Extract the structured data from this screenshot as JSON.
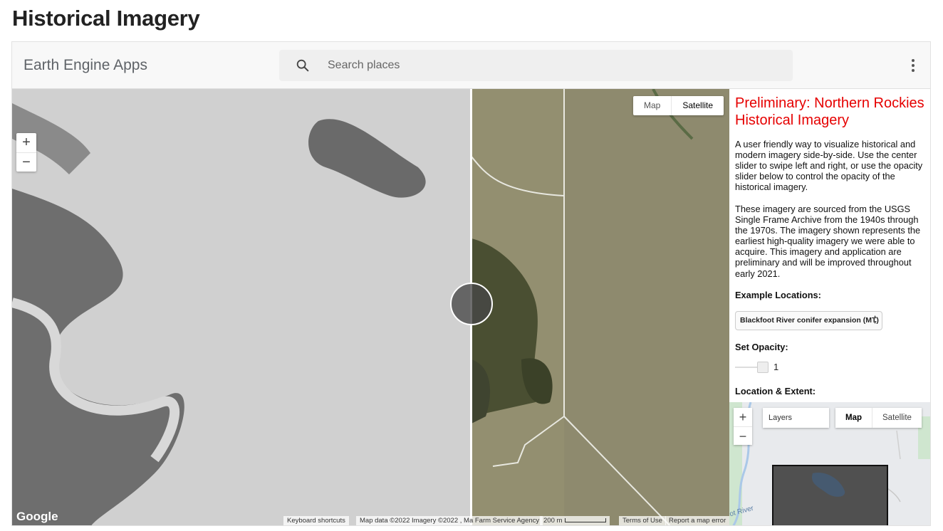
{
  "page": {
    "title": "Historical Imagery"
  },
  "header": {
    "brand": "Earth Engine Apps",
    "search_placeholder": "Search places",
    "menu_icon": "more-vert-icon"
  },
  "map": {
    "zoom_in": "+",
    "zoom_out": "−",
    "maptype_map": "Map",
    "maptype_satellite": "Satellite",
    "maptype_selected": "Satellite",
    "google_logo": "Google",
    "keyboard_shortcuts": "Keyboard shortcuts",
    "map_data": "Map data ©2022 Imagery ©2022 , Ma Farm Service Agency",
    "scale": "200 m",
    "terms": "Terms of Use",
    "report": "Report a map error"
  },
  "panel": {
    "title": "Preliminary: Northern Rockies Historical Imagery",
    "para1": "A user friendly way to visualize historical and modern imagery side-by-side. Use the center slider to swipe left and right, or use the opacity slider below to control the opacity of the historical imagery.",
    "para2": "These imagery are sourced from the USGS Single Frame Archive from the 1940s through the 1970s. The imagery shown represents the earliest high-quality imagery we were able to acquire. This imagery and application are preliminary and will be improved throughout early 2021.",
    "example_label": "Example Locations:",
    "example_selected": "Blackfoot River conifer expansion (MT)",
    "opacity_label": "Set Opacity:",
    "opacity_value": "1",
    "extent_label": "Location & Extent:"
  },
  "minimap": {
    "zoom_in": "+",
    "zoom_out": "−",
    "layers": "Layers",
    "maptype_map": "Map",
    "maptype_satellite": "Satellite",
    "maptype_selected": "Map",
    "river_label": "ot River"
  },
  "colors": {
    "panel_title": "#e60000",
    "swipe_handle": "#464646"
  }
}
